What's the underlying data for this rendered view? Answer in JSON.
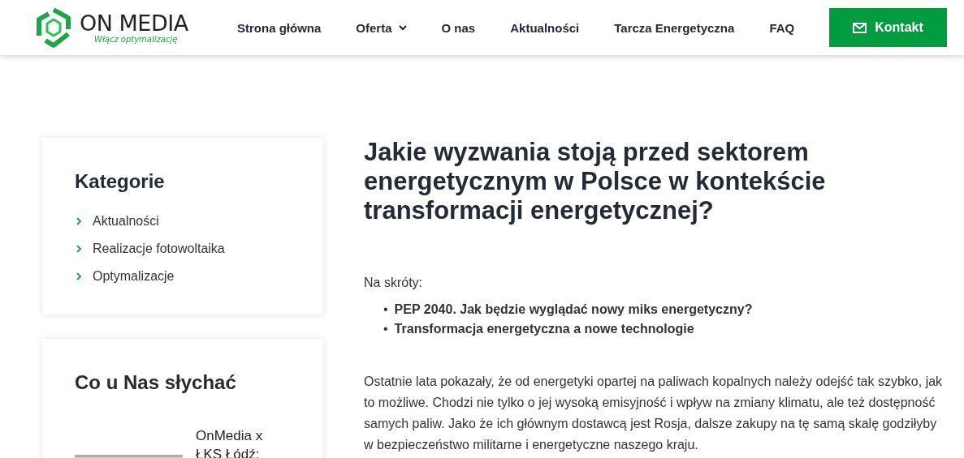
{
  "header": {
    "logo": {
      "name": "ON MEDIA",
      "tagline": "Włącz optymalizację"
    },
    "nav": [
      {
        "label": "Strona główna",
        "kind": "link"
      },
      {
        "label": "Oferta",
        "kind": "dropdown"
      },
      {
        "label": "O nas",
        "kind": "link"
      },
      {
        "label": "Aktualności",
        "kind": "link"
      },
      {
        "label": "Tarcza Energetyczna",
        "kind": "link"
      },
      {
        "label": "FAQ",
        "kind": "link"
      }
    ],
    "cta": {
      "label": "Kontakt"
    }
  },
  "sidebar": {
    "categories": {
      "title": "Kategorie",
      "items": [
        "Aktualności",
        "Realizacje fotowoltaika",
        "Optymalizacje"
      ]
    },
    "news": {
      "title": "Co u Nas słychać",
      "items": [
        {
          "title": "OnMedia x ŁKS Łódź:"
        }
      ]
    }
  },
  "article": {
    "title": "Jakie wyzwania stoją przed sektorem energetycznym w Polsce w kontekście transformacji energetycznej?",
    "intro": "Na skróty:",
    "toc": [
      {
        "marker": "•",
        "text": "PEP 2040. Jak będzie wyglądać nowy miks energetyczny?"
      },
      {
        "marker": "•",
        "text": "Transformacja energetyczna a nowe technologie"
      }
    ],
    "paragraphs": [
      "Ostatnie lata pokazały, że od energetyki opartej na paliwach kopalnych należy odejść tak szybko, jak to możliwe. Chodzi nie tylko o jej wysoką emisyjność i wpływ na zmiany klimatu, ale też dostępność samych paliw. Jako że ich głównym dostawcą jest Rosja, dalsze zakupy na tę samą skalę godziłyby w bezpieczeństwo militarne i energetyczne naszego kraju."
    ]
  }
}
